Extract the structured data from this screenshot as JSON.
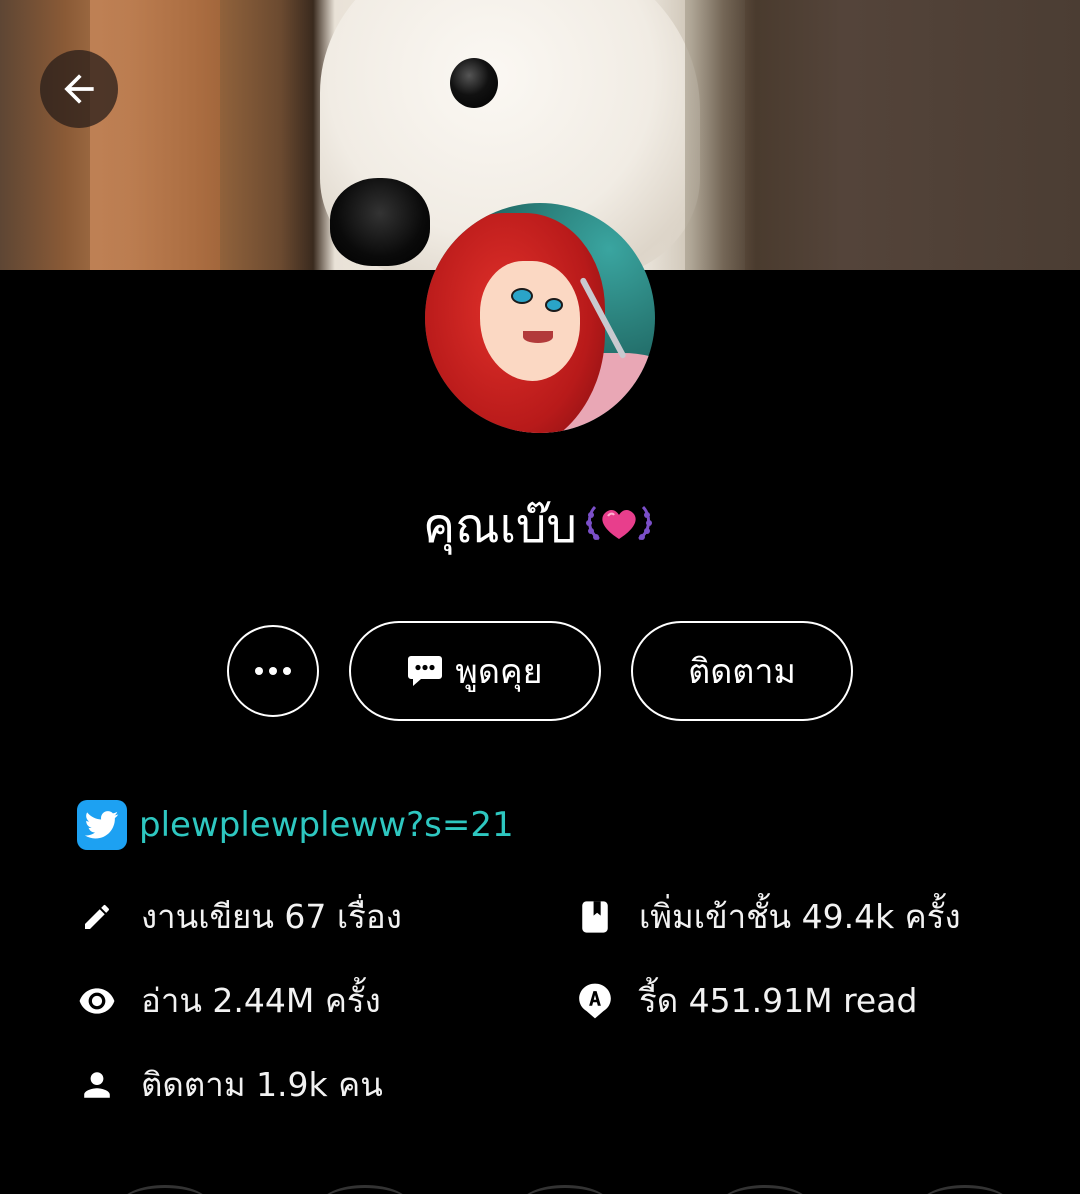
{
  "profile": {
    "display_name": "คุณเบ๊บ"
  },
  "actions": {
    "chat_label": "พูดคุย",
    "follow_label": "ติดตาม"
  },
  "social": {
    "twitter_handle": "plewplewpleww?s=21"
  },
  "stats": {
    "works": "งานเขียน 67 เรื่อง",
    "reads": "อ่าน 2.44M ครั้ง",
    "followers": "ติดตาม 1.9k คน",
    "shelf_adds": "เพิ่มเข้าชั้น 49.4k ครั้ง",
    "read_count": "รี้ด 451.91M read"
  },
  "icons": {
    "back": "arrow-left-icon",
    "more": "ellipsis-icon",
    "chat": "chat-bubble-icon",
    "twitter": "twitter-icon",
    "works": "pencil-icon",
    "reads": "eye-icon",
    "followers": "person-icon",
    "shelf": "bookmark-icon",
    "read_count": "read-badge-icon",
    "name_emoji": "heart-laurel-icon"
  },
  "colors": {
    "background": "#000000",
    "link": "#2ec7c0",
    "twitter": "#1da1f2",
    "heart": "#e83e8c",
    "laurel": "#7b4fc8"
  }
}
